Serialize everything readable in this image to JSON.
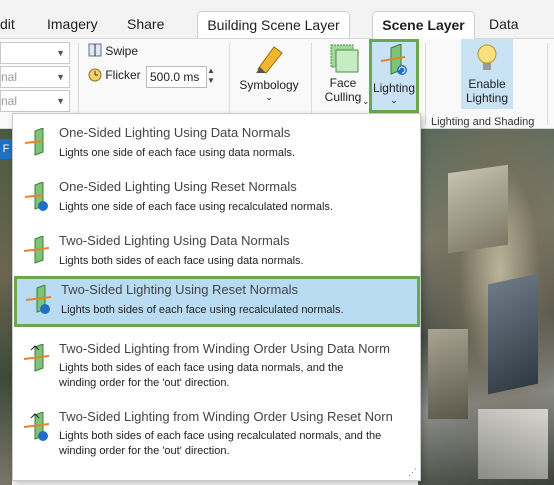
{
  "tabs": {
    "edit": "dit",
    "imagery": "Imagery",
    "share": "Share",
    "context_building": "Building Scene Layer",
    "context_scene": "Scene Layer",
    "data": "Data"
  },
  "ribbon": {
    "combo1_value": "",
    "combo2_value": "nal",
    "combo3_value": "nal",
    "swipe_label": "Swipe",
    "flicker_label": "Flicker",
    "flicker_value": "500.0",
    "flicker_unit": "ms",
    "symbology_label": "Symbology",
    "face_culling_label_1": "Face",
    "face_culling_label_2": "Culling",
    "lighting_label": "Lighting",
    "enable_lighting_1": "Enable",
    "enable_lighting_2": "Lighting",
    "group_label": "Lighting and Shading"
  },
  "menu": {
    "items": [
      {
        "title": "One-Sided Lighting Using Data Normals",
        "desc": "Lights one side of each face using data normals.",
        "selected": false
      },
      {
        "title": "One-Sided Lighting Using Reset Normals",
        "desc": "Lights one side of each face using recalculated normals.",
        "selected": false
      },
      {
        "title": "Two-Sided Lighting Using Data Normals",
        "desc": "Lights both sides of each face using data normals.",
        "selected": false
      },
      {
        "title": "Two-Sided Lighting Using Reset Normals",
        "desc": "Lights both sides of each face using recalculated normals.",
        "selected": true
      },
      {
        "title": "Two-Sided Lighting from Winding Order Using Data Norm",
        "desc_1": "Lights both sides of each face using data normals, and the",
        "desc_2": "winding order for the 'out' direction.",
        "selected": false
      },
      {
        "title": "Two-Sided Lighting from Winding Order Using Reset Norn",
        "desc_1": "Lights both sides of each face using recalculated normals, and the",
        "desc_2": "winding order for the 'out' direction.",
        "selected": false
      }
    ]
  },
  "scene_tab_letter": "F",
  "colors": {
    "selection_fill": "#b9dcf3",
    "selection_border": "#6aa84f",
    "icon_green": "#7cc576",
    "icon_blue": "#1f6fc5",
    "arrow_orange": "#e8822e"
  },
  "icons": [
    "swipe-icon",
    "flicker-icon",
    "symbology-icon",
    "face-culling-icon",
    "lighting-icon",
    "enable-lighting-icon",
    "lighting-option-icon"
  ]
}
